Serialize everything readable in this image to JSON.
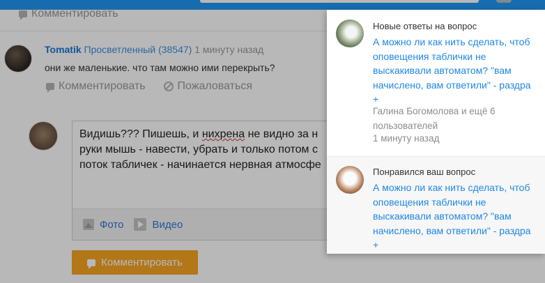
{
  "topbar": {
    "accent": "#2196f3"
  },
  "prev_comment_actions": {
    "comment_label": "Комментировать"
  },
  "comment": {
    "author": "Tomatik",
    "rank": "Просветленный (38547)",
    "time": "1 минуту назад",
    "text": "они же маленькие. что там можно ими перекрыть?",
    "actions": {
      "comment_label": "Комментировать",
      "report_label": "Пожаловаться"
    }
  },
  "editor": {
    "line1_pre": "Видишь??? Пишешь, и ",
    "line1_err": "нихрена",
    "line1_post": " не видно за н",
    "line2": "руки мышь - навести, убрать и только потом с",
    "line3": "поток табличек - начинается нервная атмосфе",
    "photo_label": "Фото",
    "video_label": "Видео"
  },
  "submit": {
    "label": "Комментировать",
    "color": "#f5a623"
  },
  "notifications": [
    {
      "title": "Новые ответы на вопрос",
      "link_lines": [
        "А можно ли как нить сделать, чтоб",
        "оповещения таблички не",
        "выскакивали автоматом? \"вам",
        "начислено, вам ответили\" - раздра",
        "+"
      ],
      "users_lines": [
        "Галина Богомолова и ещё 6",
        "пользователей"
      ],
      "time": "1 минуту назад"
    },
    {
      "title": "Понравился ваш вопрос",
      "link_lines": [
        "А можно ли как нить сделать, чтоб",
        "оповещения таблички не",
        "выскакивали автоматом? \"вам",
        "начислено, вам ответили\" - раздра",
        "+"
      ]
    }
  ]
}
